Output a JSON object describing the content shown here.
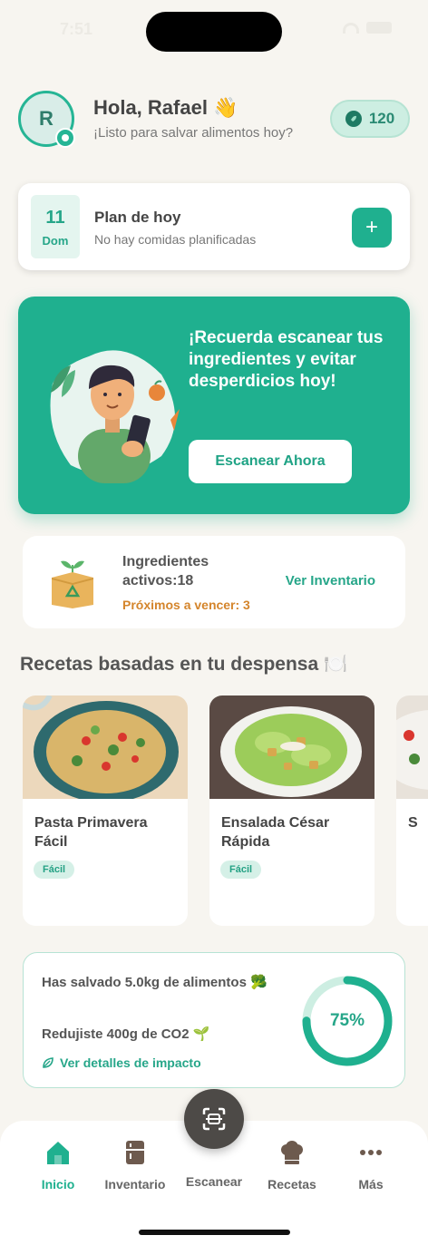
{
  "status_bar": {
    "time": "7:51"
  },
  "header": {
    "avatar_initial": "R",
    "greeting": "Hola, Rafael 👋",
    "subtitle": "¡Listo para salvar alimentos hoy?",
    "points": "120"
  },
  "plan": {
    "day": "11",
    "weekday": "Dom",
    "title": "Plan de hoy",
    "subtitle": "No hay comidas planificadas",
    "add_label": "+"
  },
  "banner": {
    "text": "¡Recuerda escanear tus ingredientes y evitar desperdicios hoy!",
    "button_label": "Escanear Ahora"
  },
  "inventory": {
    "title": "Ingredientes activos:18",
    "expiring": "Próximos a vencer: 3",
    "link": "Ver Inventario"
  },
  "recipes_section": {
    "title": "Recetas basadas en tu despensa 🍽️",
    "items": [
      {
        "name": "Pasta Primavera Fácil",
        "difficulty": "Fácil"
      },
      {
        "name": "Ensalada César Rápida",
        "difficulty": "Fácil"
      },
      {
        "name": "S",
        "difficulty": ""
      }
    ]
  },
  "impact": {
    "saved": "Has salvado 5.0kg de alimentos 🥦",
    "co2": "Redujiste 400g de CO2 🌱",
    "link": "Ver detalles de impacto",
    "percent_label": "75%",
    "percent_value": 0.75
  },
  "tabs": [
    {
      "label": "Inicio",
      "active": true
    },
    {
      "label": "Inventario",
      "active": false
    },
    {
      "label": "Escanear",
      "active": false
    },
    {
      "label": "Recetas",
      "active": false
    },
    {
      "label": "Más",
      "active": false
    }
  ],
  "colors": {
    "primary": "#1fb08f",
    "background": "#f7f5f0",
    "warning": "#d4852c"
  }
}
